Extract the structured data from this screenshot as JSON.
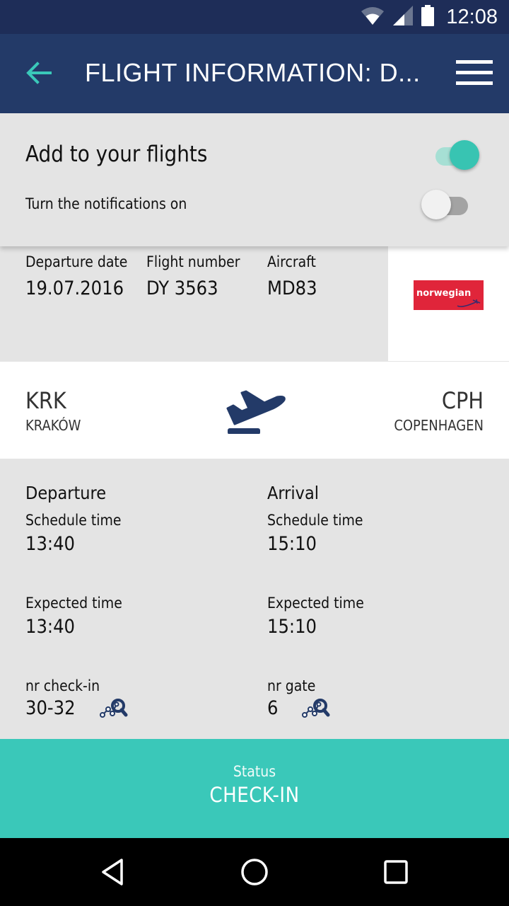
{
  "status_bar": {
    "time": "12:08",
    "icons": [
      "wifi-icon",
      "cellular-signal-icon",
      "battery-icon"
    ]
  },
  "app_bar": {
    "title": "FLIGHT INFORMATION: D...",
    "back_icon": "arrow-left-icon",
    "menu_icon": "hamburger-menu-icon",
    "accent_color": "#3ac8b9",
    "background_color": "#233a68"
  },
  "toggles": {
    "add_to_flights": {
      "label": "Add to your flights",
      "state": "on"
    },
    "notifications": {
      "label": "Turn the notifications on",
      "state": "off"
    }
  },
  "flight_info": {
    "departure_date": {
      "label": "Departure date",
      "value": "19.07.2016"
    },
    "flight_number": {
      "label": "Flight number",
      "value": "DY 3563"
    },
    "aircraft": {
      "label": "Aircraft",
      "value": "MD83"
    },
    "airline_logo": {
      "text": "norwegian",
      "color": "#e0253a"
    }
  },
  "route": {
    "from": {
      "code": "KRK",
      "city": "KRAKÓW"
    },
    "to": {
      "code": "CPH",
      "city": "COPENHAGEN"
    },
    "icon": "flight-takeoff-icon"
  },
  "times": {
    "departure": {
      "heading": "Departure",
      "schedule_label": "Schedule time",
      "schedule_value": "13:40",
      "expected_label": "Expected time",
      "expected_value": "13:40",
      "extra_label": "nr check-in",
      "extra_value": "30-32"
    },
    "arrival": {
      "heading": "Arrival",
      "schedule_label": "Schedule time",
      "schedule_value": "15:10",
      "expected_label": "Expected time",
      "expected_value": "15:10",
      "extra_label": "nr gate",
      "extra_value": "6"
    }
  },
  "status_panel": {
    "label": "Status",
    "value": "CHECK-IN",
    "color": "#3ac8b9"
  },
  "nav_bar": {
    "buttons": [
      "back-triangle-icon",
      "home-circle-icon",
      "recents-square-icon"
    ]
  }
}
